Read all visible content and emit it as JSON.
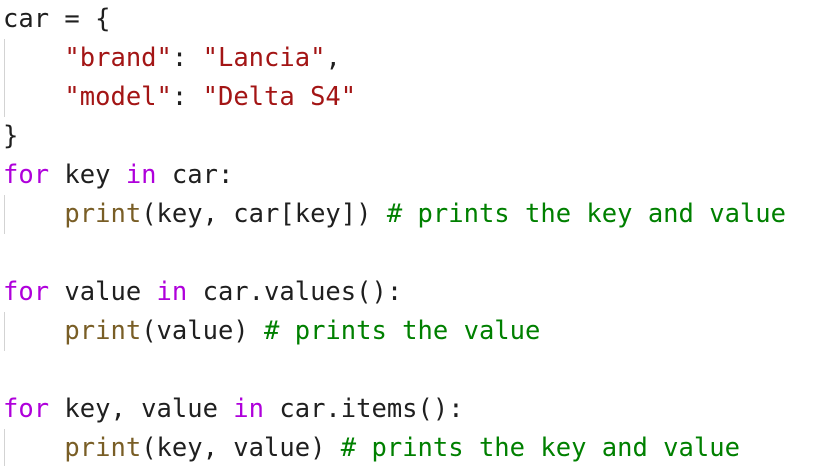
{
  "code": {
    "l1": {
      "a": "car",
      "b": " = {"
    },
    "l2": {
      "indent": "    ",
      "k": "\"brand\"",
      "sep": ": ",
      "v": "\"Lancia\"",
      "end": ","
    },
    "l3": {
      "indent": "    ",
      "k": "\"model\"",
      "sep": ": ",
      "v": "\"Delta S4\""
    },
    "l4": {
      "a": "}"
    },
    "l5": {
      "kw1": "for",
      "a": " key ",
      "kw2": "in",
      "b": " car:"
    },
    "l6": {
      "indent": "    ",
      "fn": "print",
      "a": "(key, car[key]) ",
      "cmt": "# prints the key and value"
    },
    "l8": {
      "kw1": "for",
      "a": " value ",
      "kw2": "in",
      "b": " car.values():"
    },
    "l9": {
      "indent": "    ",
      "fn": "print",
      "a": "(value) ",
      "cmt": "# prints the value"
    },
    "l11": {
      "kw1": "for",
      "a": " key, value ",
      "kw2": "in",
      "b": " car.items():"
    },
    "l12": {
      "indent": "    ",
      "fn": "print",
      "a": "(key, value) ",
      "cmt": "# prints the key and value"
    }
  },
  "colors": {
    "keyword": "#af00db",
    "string": "#a31515",
    "function": "#795e26",
    "comment": "#008000",
    "plain": "#1f1f1f",
    "indent_guide": "#d3d3d3"
  }
}
